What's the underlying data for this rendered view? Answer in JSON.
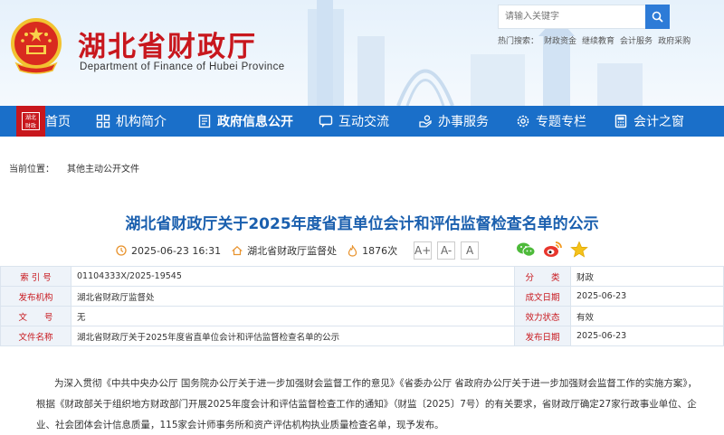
{
  "header": {
    "site_title": "湖北省财政厅",
    "site_subtitle": "Department of Finance of Hubei Province",
    "search_placeholder": "请输入关键字",
    "hot_links": [
      "热门搜索：",
      "财政资金",
      "继续教育",
      "会计服务",
      "政府采购"
    ]
  },
  "nav": {
    "logo_text": "湖北 财政",
    "items": [
      {
        "label": "首页",
        "icon": "home-icon"
      },
      {
        "label": "机构简介",
        "icon": "grid-icon"
      },
      {
        "label": "政府信息公开",
        "icon": "doc-icon",
        "active": true
      },
      {
        "label": "互动交流",
        "icon": "chat-icon"
      },
      {
        "label": "办事服务",
        "icon": "hand-icon"
      },
      {
        "label": "专题专栏",
        "icon": "gear-icon"
      },
      {
        "label": "会计之窗",
        "icon": "calc-icon"
      }
    ]
  },
  "breadcrumb": {
    "label": "当前位置：",
    "crumb": "其他主动公开文件"
  },
  "article": {
    "title": "湖北省财政厅关于2025年度省直单位会计和评估监督检查名单的公示",
    "datetime": "2025-06-23 16:31",
    "source": "湖北省财政厅监督处",
    "views": "1876次",
    "font_buttons": [
      "A+",
      "A-",
      "A"
    ],
    "paragraph": "为深入贯彻《中共中央办公厅 国务院办公厅关于进一步加强财会监督工作的意见》《省委办公厅 省政府办公厅关于进一步加强财会监督工作的实施方案》，根据《财政部关于组织地方财政部门开展2025年度会计和评估监督检查工作的通知》（财监〔2025〕7号）的有关要求，省财政厅确定27家行政事业单位、企业、社会团体会计信息质量，115家会计师事务所和资产评估机构执业质量检查名单，现予发布。"
  },
  "info_table": [
    {
      "label": "索 引 号",
      "value": "01104333X/2025-19545",
      "label2": "分　　类",
      "value2": "财政"
    },
    {
      "label": "发布机构",
      "value": "湖北省财政厅监督处",
      "label2": "成文日期",
      "value2": "2025-06-23"
    },
    {
      "label": "文　　号",
      "value": "无",
      "label2": "效力状态",
      "value2": "有效"
    },
    {
      "label": "文件名称",
      "value": "湖北省财政厅关于2025年度省直单位会计和评估监督检查名单的公示",
      "label2": "发布日期",
      "value2": "2025-06-23"
    }
  ],
  "colors": {
    "brand_red": "#c8171d",
    "nav_blue": "#1a6fc9",
    "title_blue": "#1a5fae"
  }
}
